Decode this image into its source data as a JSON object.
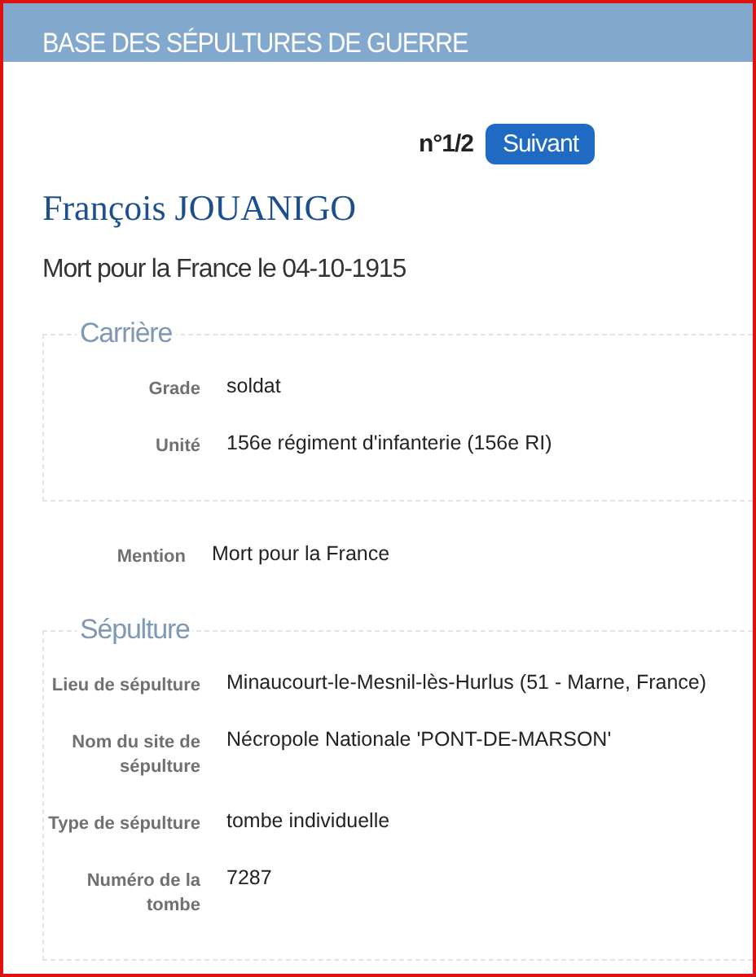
{
  "header": {
    "title": "BASE DES SÉPULTURES DE GUERRE"
  },
  "pager": {
    "counter": "n°1/2",
    "next_button": "Suivant"
  },
  "person": {
    "name": "François JOUANIGO",
    "subtitle": "Mort pour la France le 04-10-1915"
  },
  "sections": [
    {
      "kind": "group",
      "legend": "Carrière",
      "fields": [
        {
          "label": "Grade",
          "value": "soldat"
        },
        {
          "label": "Unité",
          "value": "156e régiment d'infanterie (156e RI)"
        }
      ]
    },
    {
      "kind": "plain",
      "fields": [
        {
          "label": "Mention",
          "value": "Mort pour la France"
        }
      ]
    },
    {
      "kind": "group",
      "legend": "Sépulture",
      "fields": [
        {
          "label": "Lieu de sépulture",
          "value": "Minaucourt-le-Mesnil-lès-Hurlus (51 - Marne, France)"
        },
        {
          "label": "Nom du site de sépulture",
          "value": "Nécropole Nationale 'PONT-DE-MARSON'"
        },
        {
          "label": "Type de sépulture",
          "value": "tombe individuelle"
        },
        {
          "label": "Numéro de la tombe",
          "value": "7287"
        }
      ]
    }
  ]
}
